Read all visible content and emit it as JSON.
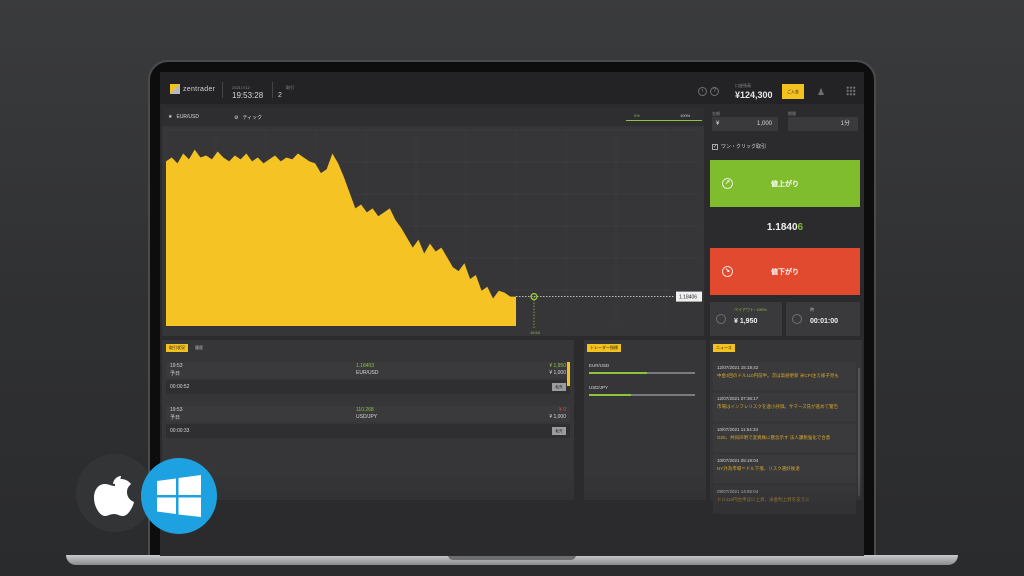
{
  "app": {
    "logo_text": "zentrader"
  },
  "header": {
    "date": "2021/7/12",
    "time": "19:53:28",
    "positions_label": "取引",
    "positions_count": "2",
    "balance_label": "口座残高",
    "balance": "¥124,300",
    "deposit_label": "ご入金"
  },
  "chart_toolbar": {
    "pair": "EUR/USD",
    "chart_type": "ティック",
    "pct_left": "0%",
    "pct_right": "100%"
  },
  "chart": {
    "price_label": "1.18406",
    "time_marker": "19:54"
  },
  "chart_data": {
    "type": "area",
    "title": "",
    "xlabel": "",
    "ylabel": "",
    "color": "#f6c324",
    "ylim": [
      0,
      100
    ],
    "values": [
      84,
      86,
      83,
      88,
      85,
      90,
      86,
      87,
      85,
      89,
      86,
      84,
      87,
      85,
      88,
      84,
      86,
      83,
      85,
      87,
      84,
      86,
      85,
      88,
      86,
      84,
      83,
      78,
      80,
      88,
      83,
      76,
      68,
      60,
      62,
      58,
      60,
      56,
      58,
      60,
      54,
      50,
      45,
      40,
      44,
      37,
      42,
      38,
      40,
      35,
      30,
      28,
      32,
      24,
      26,
      18,
      20,
      14,
      18,
      17,
      15,
      15
    ]
  },
  "trade": {
    "amount_label": "金額",
    "amount_currency": "¥",
    "amount_value": "1,000",
    "period_label": "期間",
    "period_value": "1分",
    "oneclick_label": "ワン・クリック取引",
    "up_label": "値上がり",
    "down_label": "値下がり",
    "price_main": "1.1840",
    "price_last": "6",
    "payout_label": "ペイアウト: 195%",
    "payout_value": "¥ 1,950",
    "timer_label": "時",
    "timer_value": "00:01:00"
  },
  "positions": {
    "tab_active": "取引状況",
    "tab_idle": "履歴",
    "sell_label": "転売",
    "items": [
      {
        "time": "19:53",
        "side": "予日",
        "rate": "1.18403",
        "pair": "EUR/USD",
        "amount": "¥ 1,950",
        "stake": "¥ 1,000",
        "countdown": "00:00:52",
        "amount_color": "#8fc23d"
      },
      {
        "time": "19:53",
        "side": "予日",
        "rate": "110.268",
        "pair": "USD/JPY",
        "amount": "¥ 0",
        "stake": "¥ 1,000",
        "countdown": "00:00:33",
        "amount_color": "#e14a2f"
      }
    ]
  },
  "sentiment": {
    "tab": "トレーダー指標",
    "rows": [
      {
        "pair": "EUR/USD",
        "pct": 0.55
      },
      {
        "pair": "USD/JPY",
        "pct": 0.4
      }
    ]
  },
  "news": {
    "tab": "ニュース",
    "items": [
      {
        "date": "12/07/2021 15:18:42",
        "text": "中金3回のドル110円前半。次は高値更新 米CPI注え様子見も"
      },
      {
        "date": "12/07/2021 07:36:17",
        "text": "市場はインフレリスクを過小評価。サマーズ氏が進めて警告"
      },
      {
        "date": "10/07/2021 11:54:33",
        "text": "G20、共同声明で変異株に懸念示す 法人課税強化で合意"
      },
      {
        "date": "10/07/2021 05:19:04",
        "text": "NY外為市場＝ドル下落、リスク選好後退"
      },
      {
        "date": "09/07/2021 14:55:04",
        "text": "ドル110円台半ばに上昇、米金利上昇を支えに"
      }
    ]
  }
}
